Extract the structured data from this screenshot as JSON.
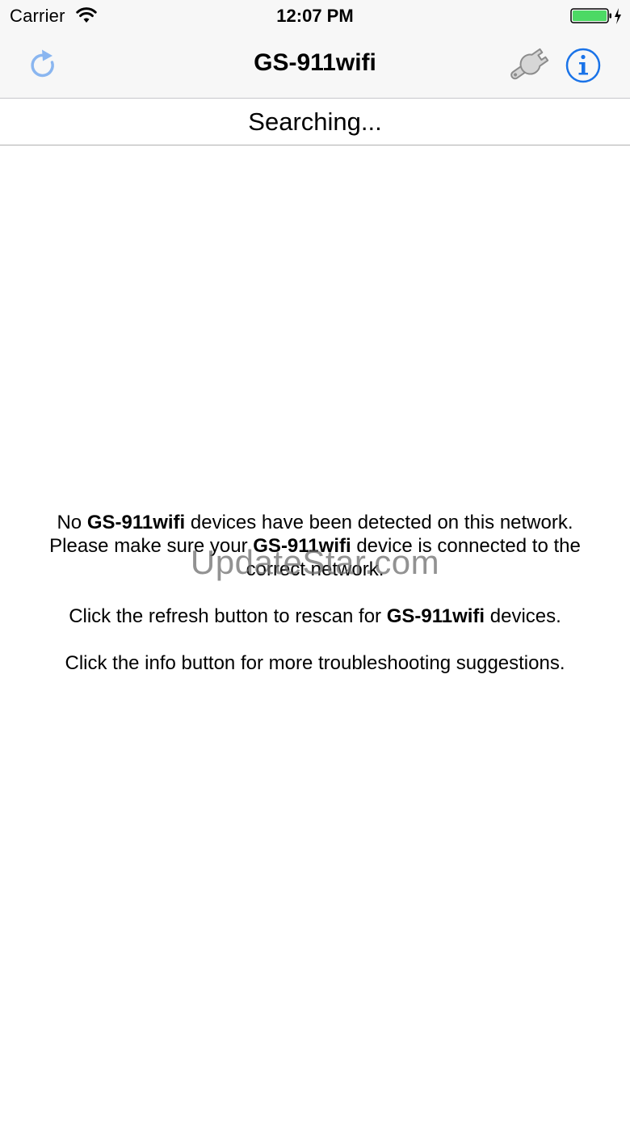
{
  "status_bar": {
    "carrier": "Carrier",
    "time": "12:07 PM",
    "battery_color": "#4cd964"
  },
  "nav": {
    "title": "GS-911wifi",
    "refresh_icon": "refresh-icon",
    "wrench_icon": "wrench-icon",
    "info_icon": "info-icon",
    "accent_color": "#1a73e8"
  },
  "search_status": "Searching...",
  "message": {
    "l1_pre": "No ",
    "l1_bold": "GS-911wifi",
    "l1_post": " devices have been detected on this network.",
    "l2_pre": "Please make sure your ",
    "l2_bold": "GS-911wifi",
    "l2_post": " device is connected to the",
    "l3": "correct network.",
    "l4_pre": "Click the refresh button to rescan for ",
    "l4_bold": "GS-911wifi",
    "l4_post": " devices.",
    "l5": "Click the info button for more troubleshooting suggestions."
  },
  "watermark": "UpdateStar.com"
}
